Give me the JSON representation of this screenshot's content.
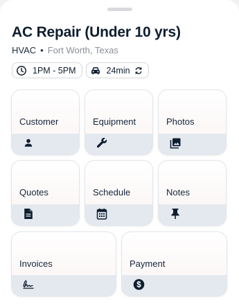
{
  "job": {
    "title": "AC Repair (Under 10 yrs)",
    "category": "HVAC",
    "separator": "•",
    "location": "Fort Worth, Texas"
  },
  "chips": {
    "time_window": "1PM - 5PM",
    "drive_time": "24min"
  },
  "tiles": [
    {
      "label": "Customer",
      "icon": "person-icon"
    },
    {
      "label": "Equipment",
      "icon": "wrench-icon"
    },
    {
      "label": "Photos",
      "icon": "photos-icon"
    },
    {
      "label": "Quotes",
      "icon": "document-icon"
    },
    {
      "label": "Schedule",
      "icon": "calendar-icon"
    },
    {
      "label": "Notes",
      "icon": "pin-icon"
    },
    {
      "label": "Invoices",
      "icon": "signature-icon"
    },
    {
      "label": "Payment",
      "icon": "dollar-coin-icon"
    }
  ],
  "colors": {
    "text_dark": "#0f1e2f",
    "icon_band": "#e4e8ef",
    "muted_text": "#8a8f98"
  }
}
